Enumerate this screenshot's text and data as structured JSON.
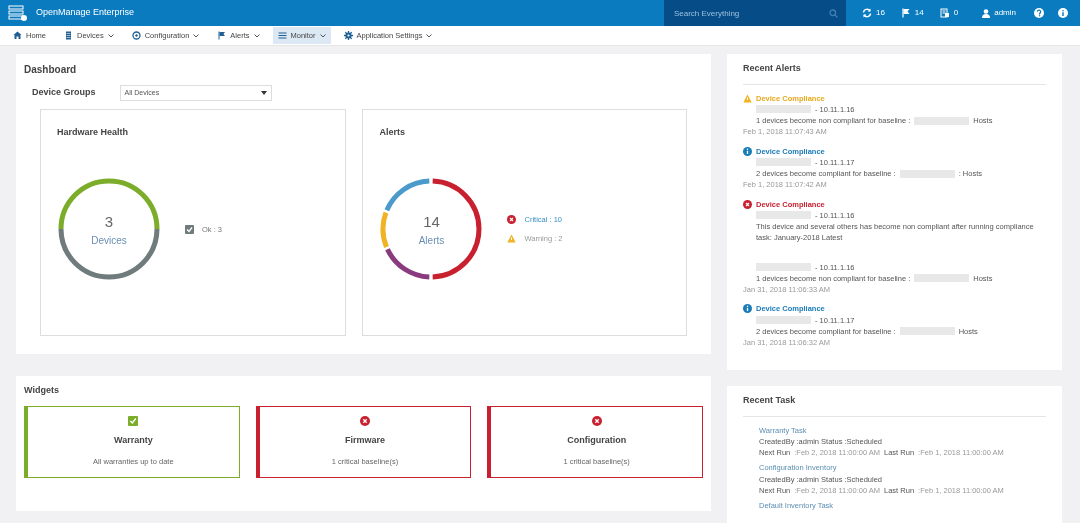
{
  "app": {
    "title": "OpenManage Enterprise"
  },
  "search": {
    "placeholder": "Search Everything"
  },
  "header_stats": [
    {
      "kind": "sync",
      "text": "16"
    },
    {
      "kind": "flag",
      "text": "14"
    },
    {
      "kind": "job",
      "text": "0"
    }
  ],
  "user": {
    "name": "admin"
  },
  "nav": [
    {
      "kind": "home",
      "label": "Home",
      "selected": false,
      "has_menu": false
    },
    {
      "kind": "devices",
      "label": "Devices",
      "selected": false,
      "has_menu": true
    },
    {
      "kind": "config",
      "label": "Configuration",
      "selected": false,
      "has_menu": true
    },
    {
      "kind": "flag",
      "label": "Alerts",
      "selected": false,
      "has_menu": true
    },
    {
      "kind": "monitor",
      "label": "Monitor",
      "selected": true,
      "has_menu": true
    },
    {
      "kind": "gear",
      "label": "Application Settings",
      "selected": false,
      "has_menu": true
    }
  ],
  "dashboard": {
    "title": "Dashboard",
    "group_label": "Device Groups",
    "group_value": "All Devices",
    "hardware": {
      "title": "Hardware Health",
      "center_value": "3",
      "center_label": "Devices",
      "legend": [
        {
          "kind": "ok",
          "label": "Ok : 3"
        }
      ]
    },
    "alerts": {
      "title": "Alerts",
      "center_value": "14",
      "center_label": "Alerts",
      "legend": [
        {
          "kind": "critical",
          "label": "Critical : 10"
        },
        {
          "kind": "warning",
          "label": "Warning : 2"
        }
      ]
    }
  },
  "widgets": {
    "title": "Widgets",
    "items": [
      {
        "kind": "ok",
        "title": "Warranty",
        "text": "All warranties up to date"
      },
      {
        "kind": "critical",
        "title": "Firmware",
        "text": "1 critical baseline(s)"
      },
      {
        "kind": "critical",
        "title": "Configuration",
        "text": "1 critical baseline(s)"
      }
    ]
  },
  "recent_alerts": {
    "title": "Recent Alerts",
    "items": [
      {
        "kind": "warning",
        "title": "Device Compliance",
        "source": "- 10.11.1.16",
        "message": "1 devices become non compliant for baseline :",
        "message_end": "Hosts",
        "time": "Feb 1, 2018 11:07:43 AM"
      },
      {
        "kind": "info",
        "title": "Device Compliance",
        "source": "- 10.11.1.17",
        "message": "2 devices become compliant for baseline :",
        "message_end": ": Hosts",
        "time": "Feb 1, 2018 11:07:42 AM"
      },
      {
        "kind": "critical",
        "title": "Device Compliance",
        "source": "- 10.11.1.16",
        "message": "This device and several others has become non compliant after running compliance task: January-2018 Latest"
      },
      {
        "source": "- 10.11.1.16",
        "message": "1 devices become non compliant for baseline :",
        "message_end": "Hosts",
        "time": "Jan 31, 2018 11:06:33 AM"
      },
      {
        "kind": "info",
        "title": "Device Compliance",
        "source": "- 10.11.1.17",
        "message": "2 devices become compliant for baseline :",
        "message_end": "Hosts",
        "time": "Jan 31, 2018 11:06:32 AM"
      }
    ]
  },
  "recent_task": {
    "title": "Recent Task",
    "items": [
      {
        "name": "Warranty Task",
        "info": "CreatedBy :admin Status :Scheduled",
        "next_label": "Next Run",
        "next_value": ":Feb 2, 2018 11:00:00 AM",
        "last_label": "Last Run",
        "last_value": ":Feb 1, 2018 11:00:00 AM"
      },
      {
        "name": "Configuration Inventory",
        "info": "CreatedBy :admin Status :Scheduled",
        "next_label": "Next Run",
        "next_value": ":Feb 2, 2018 11:00:00 AM",
        "last_label": "Last Run",
        "last_value": ":Feb 1, 2018 11:00:00 AM"
      },
      {
        "name": "Default Inventory Task"
      }
    ]
  }
}
